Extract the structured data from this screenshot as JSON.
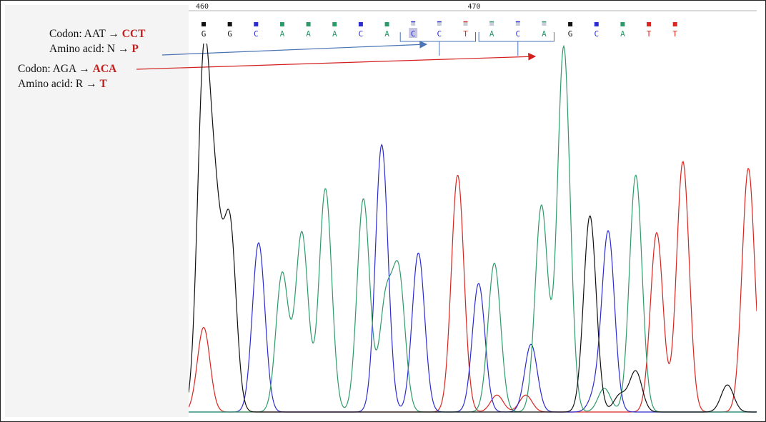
{
  "annotations": [
    {
      "label": "Codon: AAT → ",
      "mut": "CCT"
    },
    {
      "label": "Amino acid: N → ",
      "mut": "P"
    },
    {
      "label": "Codon: AGA → ",
      "mut": "ACA"
    },
    {
      "label": "Amino acid: R → ",
      "mut": "T"
    }
  ],
  "colors": {
    "A": "#2e9a6a",
    "C": "#2b2bcf",
    "G": "#111111",
    "T": "#d9251f",
    "blue_arrow": "#4a74b5",
    "red_arrow": "#d2201f",
    "bracket": "#4a74b5"
  },
  "chart_data": {
    "type": "line",
    "position_labels": [
      {
        "text": "460",
        "base": 0
      },
      {
        "text": "470",
        "base": 10
      }
    ],
    "bases": [
      "G",
      "G",
      "C",
      "A",
      "A",
      "A",
      "C",
      "A",
      "C",
      "C",
      "T",
      "A",
      "C",
      "A",
      "G",
      "C",
      "A",
      "T",
      "T"
    ],
    "highlighted_bases": [
      8
    ],
    "codon_brackets": [
      [
        8,
        10
      ],
      [
        11,
        13
      ]
    ],
    "y_range": [
      0,
      100
    ],
    "series": [
      {
        "base": "G",
        "peaks": [
          [
            0.0,
            100
          ],
          [
            0.45,
            53
          ],
          [
            1.0,
            55
          ],
          [
            14.75,
            58
          ],
          [
            15.9,
            5
          ],
          [
            16.5,
            12
          ],
          [
            20.0,
            8
          ],
          [
            25.1,
            8
          ]
        ]
      },
      {
        "base": "C",
        "peaks": [
          [
            2.1,
            50
          ],
          [
            6.8,
            79
          ],
          [
            8.2,
            47
          ],
          [
            10.5,
            38
          ],
          [
            12.5,
            20
          ],
          [
            14.95,
            5
          ],
          [
            15.45,
            53
          ]
        ]
      },
      {
        "base": "A",
        "peaks": [
          [
            3.0,
            41
          ],
          [
            3.75,
            53
          ],
          [
            4.65,
            66
          ],
          [
            6.1,
            63
          ],
          [
            6.95,
            32
          ],
          [
            7.45,
            40
          ],
          [
            11.1,
            44
          ],
          [
            12.9,
            61
          ],
          [
            13.75,
            108
          ],
          [
            15.3,
            7
          ],
          [
            16.5,
            70
          ],
          [
            24.8,
            75
          ]
        ]
      },
      {
        "base": "T",
        "peaks": [
          [
            0.0,
            25
          ],
          [
            9.7,
            70
          ],
          [
            11.2,
            5
          ],
          [
            12.3,
            5
          ],
          [
            17.3,
            53
          ],
          [
            18.3,
            74
          ],
          [
            20.8,
            72
          ]
        ]
      }
    ]
  }
}
